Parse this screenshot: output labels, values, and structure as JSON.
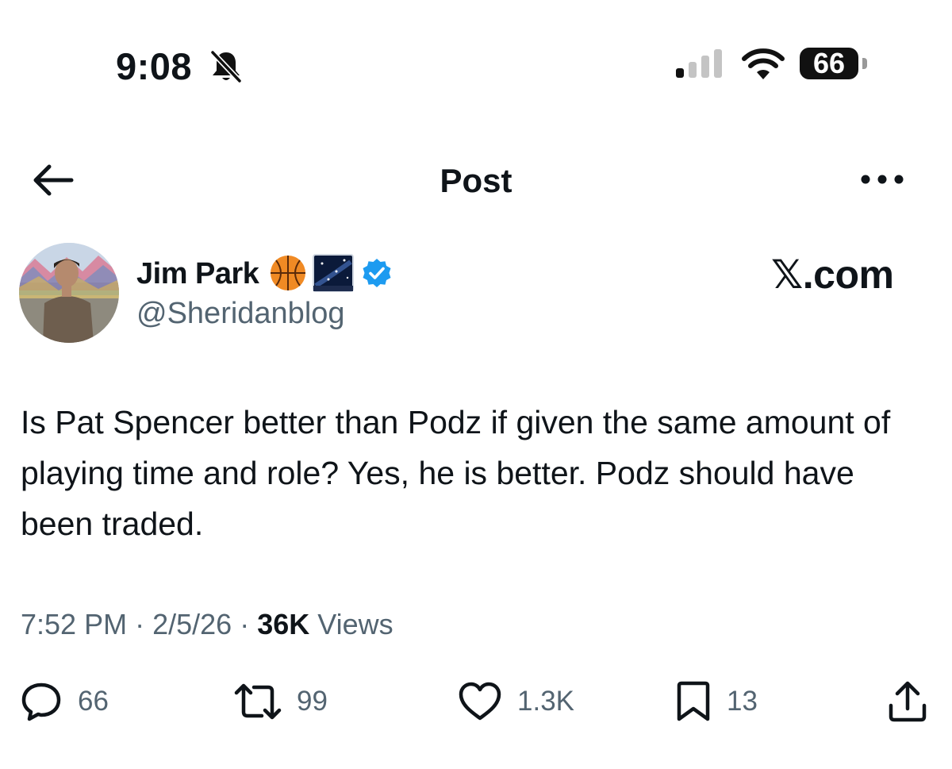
{
  "status_bar": {
    "time": "9:08",
    "battery_level": "66",
    "icons": [
      "bell-off-icon",
      "cellular-signal-icon",
      "wifi-icon",
      "battery-icon"
    ]
  },
  "header": {
    "title": "Post",
    "back_icon": "arrow-left-icon",
    "more_icon": "ellipsis-icon"
  },
  "author": {
    "name": "Jim Park",
    "handle": "@Sheridanblog",
    "badges": [
      "basketball-emoji",
      "night-sky-emoji",
      "verified-badge-icon"
    ],
    "verified_color": "#1d9bf0"
  },
  "brand_label": "𝕏.com",
  "post": {
    "text": "Is Pat Spencer better than Podz if given the same amount of playing time and role? Yes, he is better. Podz should have been traded."
  },
  "meta": {
    "time": "7:52 PM",
    "date": "2/5/26",
    "views_count": "36K",
    "views_label": "Views",
    "separator": "·"
  },
  "actions": {
    "replies": "66",
    "reposts": "99",
    "likes": "1.3K",
    "bookmarks": "13"
  },
  "colors": {
    "text_primary": "#0f1419",
    "text_secondary": "#536471",
    "accent": "#1d9bf0"
  }
}
